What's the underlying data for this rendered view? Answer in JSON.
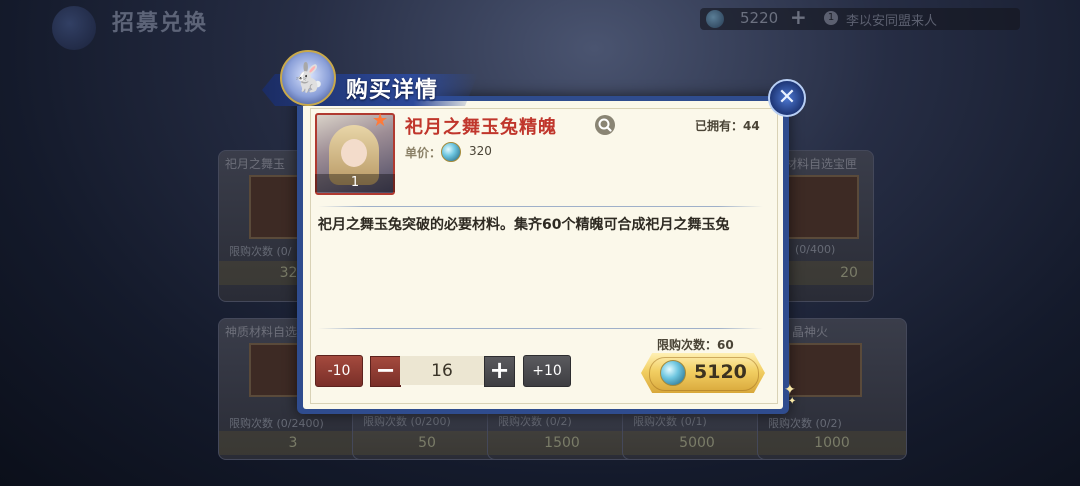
{
  "background": {
    "page_title": "招募兑换",
    "currency_value": "5220",
    "currency_plus": "+",
    "notice_badge": "1",
    "notice_text": "李以安同盟来人",
    "cards": [
      {
        "name": "祀月之舞玉",
        "limit": "限购次数 (0/",
        "price": "320"
      },
      {
        "name": "材料自选宝匣",
        "limit": "(0/400)",
        "price": "20"
      },
      {
        "name": "神质材料自选",
        "limit": "限购次数 (0/2400)",
        "price": "3"
      },
      {
        "name": "",
        "limit": "限购次数 (0/200)",
        "price": "50"
      },
      {
        "name": "",
        "limit": "限购次数 (0/2)",
        "price": "1500"
      },
      {
        "name": "",
        "limit": "限购次数 (0/1)",
        "price": "5000"
      },
      {
        "name": "晶神火",
        "limit": "限购次数 (0/2)",
        "price": "1000"
      }
    ]
  },
  "dialog": {
    "title": "购买详情",
    "close_icon": "close-icon",
    "item": {
      "name": "祀月之舞玉兔精魄",
      "count": "1",
      "owned_label": "已拥有：44",
      "unit_price_label": "单价：",
      "unit_price": "320",
      "description": "祀月之舞玉兔突破的必要材料。集齐60个精魄可合成祀月之舞玉兔"
    },
    "limit_label": "限购次数：60",
    "controls": {
      "minus10_label": "-10",
      "minus_label": "−",
      "quantity": "16",
      "plus_label": "+",
      "plus10_label": "+10"
    },
    "buy_price": "5120"
  },
  "colors": {
    "dialog_frame": "#2f4c8e",
    "panel": "#fbf8ea",
    "item_name": "#c0362c",
    "buy_button": "#f2cf63",
    "minus_button": "#8e3a31"
  }
}
